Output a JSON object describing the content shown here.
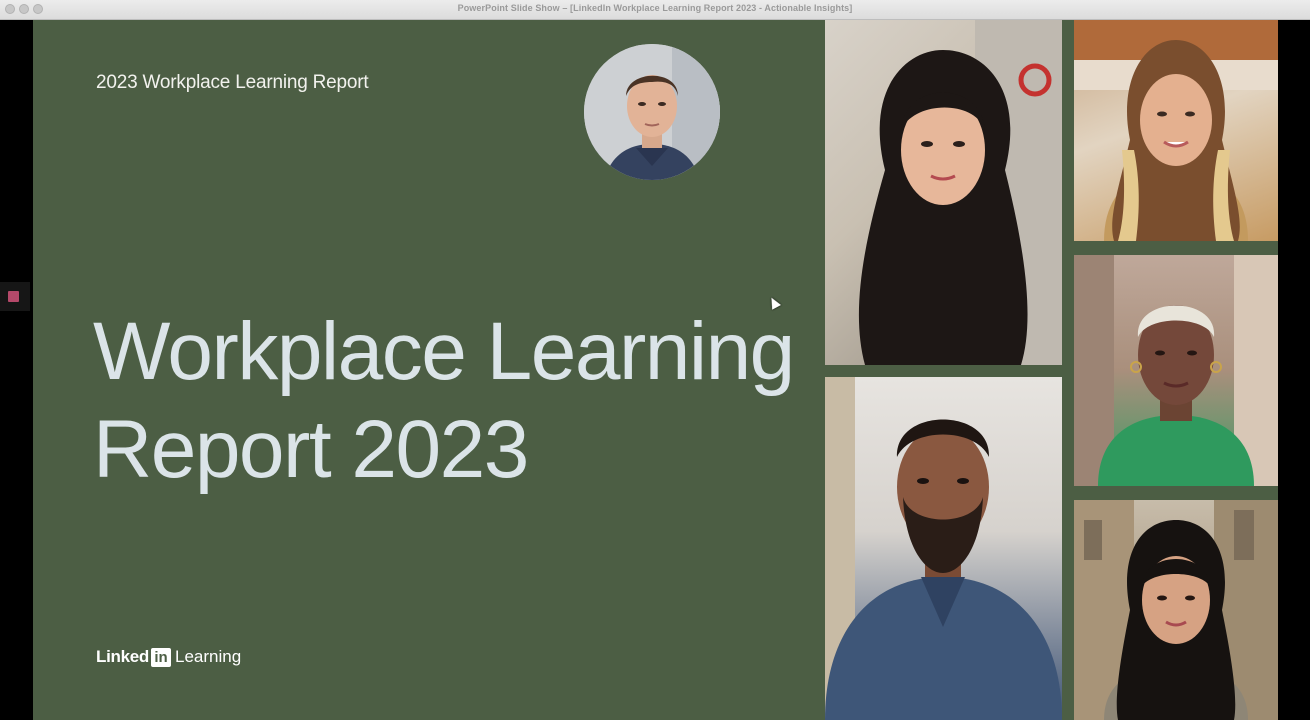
{
  "window": {
    "title": "PowerPoint Slide Show – [LinkedIn Workplace Learning Report 2023 - Actionable Insights]"
  },
  "slide": {
    "report_label": "2023 Workplace Learning Report",
    "headline_line1": "Workplace Learning",
    "headline_line2": "Report 2023",
    "brand": {
      "linked": "Linked",
      "in": "in",
      "learning": "Learning"
    }
  },
  "colors": {
    "slide_background": "#4c5e44",
    "headline": "#dbe4e8",
    "side_indicator": "#b5496a"
  },
  "icons": {
    "close": "close-button-icon",
    "minimize": "minimize-button-icon",
    "maximize": "maximize-button-icon",
    "cursor": "mouse-pointer-icon"
  }
}
